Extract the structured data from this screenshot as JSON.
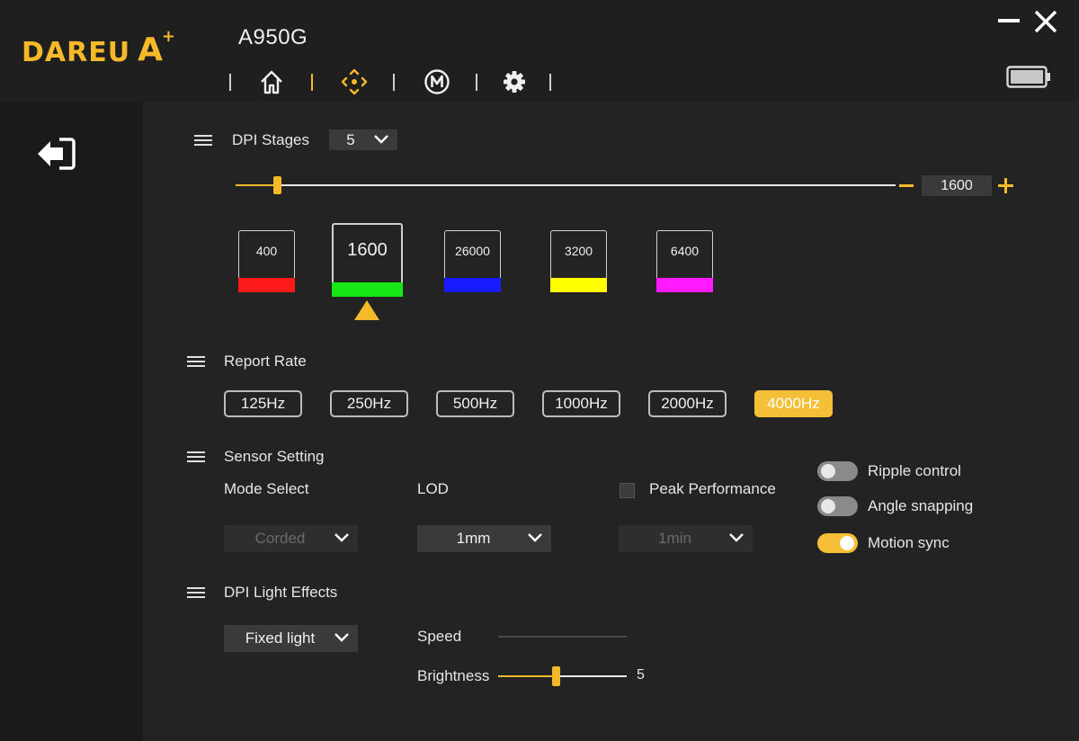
{
  "app": {
    "logo_text": "DAREU",
    "logo_mark": "A",
    "logo_plus": "+",
    "device_name": "A950G"
  },
  "nav": [
    {
      "name": "home",
      "icon": "home-icon"
    },
    {
      "name": "dpi",
      "icon": "crosshair-icon",
      "active": true
    },
    {
      "name": "macro",
      "icon": "macro-m-icon"
    },
    {
      "name": "settings",
      "icon": "gear-icon"
    }
  ],
  "window": {
    "minimize_icon": "minimize-icon",
    "close_icon": "close-icon",
    "battery_icon": "battery-icon"
  },
  "dpi": {
    "title": "DPI Stages",
    "stages_count": "5",
    "current_value": "1600",
    "minus": "−",
    "stages": [
      {
        "value": "400",
        "color": "#ff1a1a"
      },
      {
        "value": "1600",
        "color": "#17e617",
        "selected": true
      },
      {
        "value": "26000",
        "color": "#1a1aff"
      },
      {
        "value": "3200",
        "color": "#ffff00"
      },
      {
        "value": "6400",
        "color": "#ff1aff"
      }
    ]
  },
  "report_rate": {
    "title": "Report Rate",
    "options": [
      "125Hz",
      "250Hz",
      "500Hz",
      "1000Hz",
      "2000Hz",
      "4000Hz"
    ],
    "selected": "4000Hz"
  },
  "sensor": {
    "title": "Sensor Setting",
    "mode_label": "Mode Select",
    "mode_value": "Corded",
    "lod_label": "LOD",
    "lod_value": "1mm",
    "peak_label": "Peak Performance",
    "peak_value": "1min",
    "toggles": [
      {
        "label": "Ripple control",
        "on": false
      },
      {
        "label": "Angle snapping",
        "on": false
      },
      {
        "label": "Motion sync",
        "on": true
      }
    ]
  },
  "light": {
    "title": "DPI Light Effects",
    "effect_value": "Fixed light",
    "speed_label": "Speed",
    "brightness_label": "Brightness",
    "brightness_value": "5"
  },
  "colors": {
    "accent": "#f5b92a",
    "bg": "#232323",
    "header": "#1f1f1f",
    "sidebar": "#1a1a1a"
  }
}
